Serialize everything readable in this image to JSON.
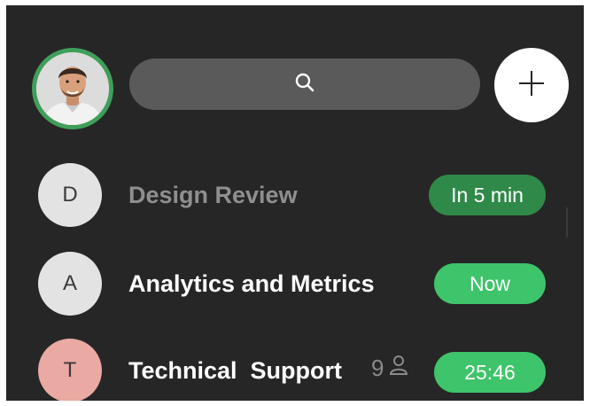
{
  "colors": {
    "background": "#262626",
    "search_bg": "#5a5a5a",
    "accent_green": "#3f9e5a",
    "badge_dark_green": "#2f8a4a",
    "badge_bright_green": "#3ec46a",
    "avatar_grey": "#e3e3e3",
    "avatar_pink": "#eaa9a3",
    "title_muted": "#8f8f8f",
    "title_white": "#ffffff"
  },
  "header": {
    "user_avatar_icon": "user-avatar-photo",
    "search_icon": "search-icon",
    "add_icon": "plus-icon"
  },
  "meetings": [
    {
      "initial": "D",
      "title": "Design Review",
      "status": "In 5 min",
      "avatar_color": "#e3e3e3",
      "title_color": "#8f8f8f",
      "badge_color": "#2f8a4a"
    },
    {
      "initial": "A",
      "title": "Analytics and Metrics",
      "status": "Now",
      "avatar_color": "#e3e3e3",
      "title_color": "#ffffff",
      "badge_color": "#3ec46a"
    },
    {
      "initial": "T",
      "title": "Technical  Support",
      "participants": "9",
      "participants_icon": "person-icon",
      "status": "25:46",
      "avatar_color": "#eaa9a3",
      "title_color": "#ffffff",
      "badge_color": "#3ec46a"
    }
  ]
}
